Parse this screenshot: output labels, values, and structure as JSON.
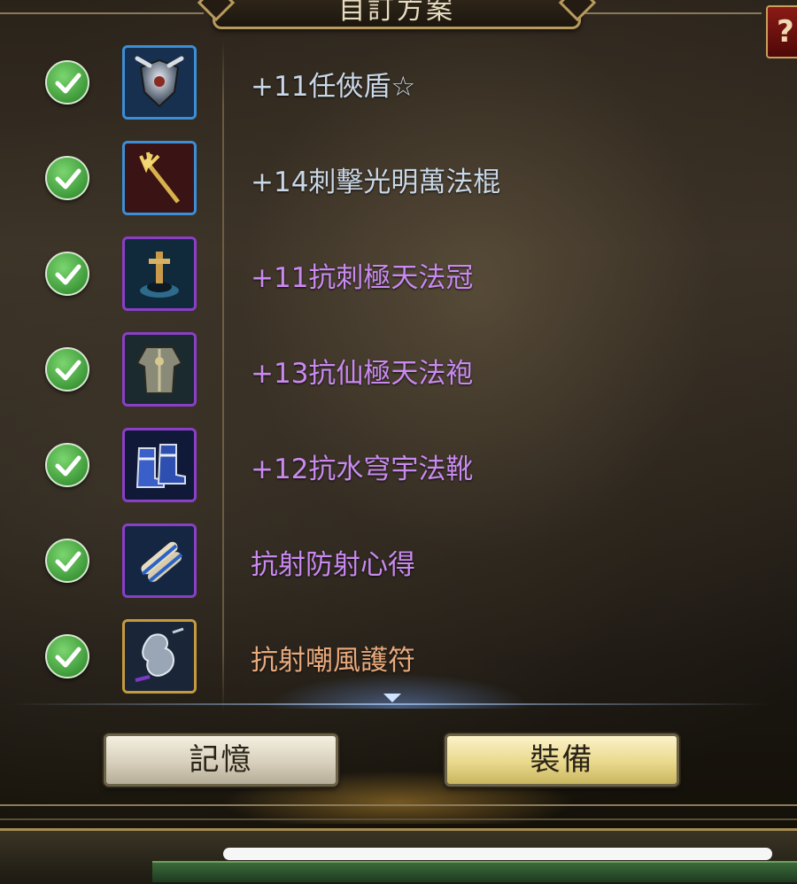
{
  "header": {
    "title": "自訂方案",
    "help_label": "?"
  },
  "colors": {
    "name_blue": "#c9d7e6",
    "name_purple": "#c98af0",
    "name_orange": "#e7a97c",
    "check_green": "#4caf50"
  },
  "items": [
    {
      "name": "+11任俠盾☆",
      "rarity": "blue",
      "icon": "shield-icon",
      "checked": true
    },
    {
      "name": "+14刺擊光明萬法棍",
      "rarity": "blue",
      "icon": "staff-icon",
      "checked": true
    },
    {
      "name": "+11抗刺極天法冠",
      "rarity": "purple",
      "icon": "crown-icon",
      "checked": true
    },
    {
      "name": "+13抗仙極天法袍",
      "rarity": "purple",
      "icon": "robe-icon",
      "checked": true
    },
    {
      "name": "+12抗水穹宇法靴",
      "rarity": "purple",
      "icon": "boots-icon",
      "checked": true
    },
    {
      "name": "抗射防射心得",
      "rarity": "purple",
      "icon": "scroll-icon",
      "checked": true
    },
    {
      "name": "抗射嘲風護符",
      "rarity": "gold",
      "icon": "amulet-icon",
      "checked": true
    }
  ],
  "buttons": {
    "memory_label": "記憶",
    "equip_label": "裝備"
  }
}
